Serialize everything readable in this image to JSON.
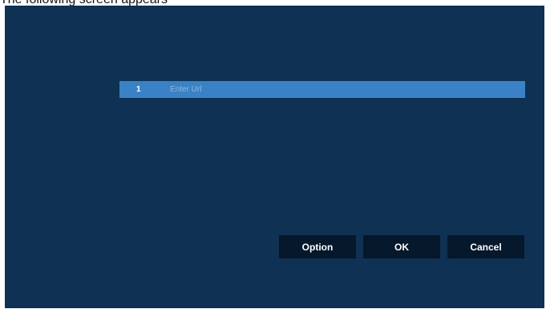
{
  "caption": {
    "text": "The following screen appears"
  },
  "url_list": {
    "rows": [
      {
        "index": "1",
        "placeholder": "Enter Url"
      }
    ]
  },
  "buttons": {
    "option": "Option",
    "ok": "OK",
    "cancel": "Cancel"
  },
  "colors": {
    "background": "#0f3154",
    "selected_row": "#3a82c5",
    "button": "#05182c"
  }
}
